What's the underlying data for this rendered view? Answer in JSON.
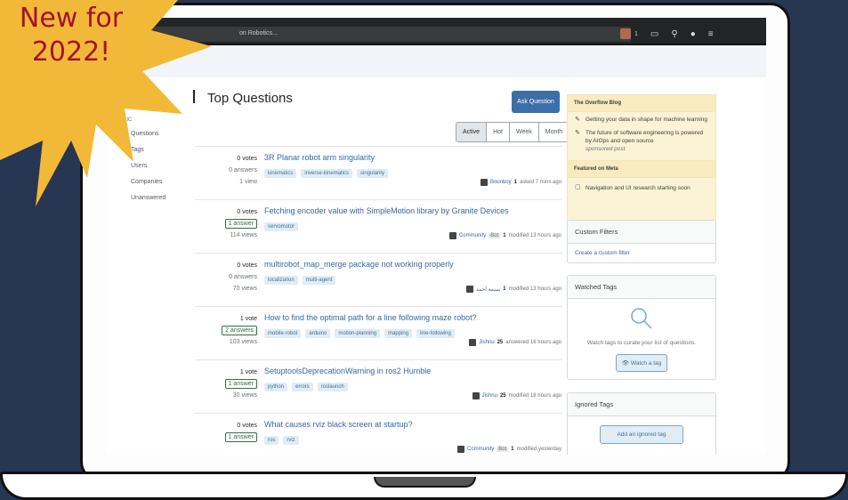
{
  "promo": {
    "line1": "New for",
    "line2": "2022!"
  },
  "topbar": {
    "search_placeholder": "on Robotics...",
    "rep": "1"
  },
  "nav": {
    "section": "LIC",
    "items": [
      "Questions",
      "Tags",
      "Users",
      "Companies",
      "Unanswered"
    ]
  },
  "main": {
    "title": "Top Questions",
    "ask_button": "Ask Question",
    "filters": [
      "Active",
      "Hot",
      "Week",
      "Month"
    ],
    "questions": [
      {
        "votes": "0 votes",
        "answers": "0 answers",
        "views": "1 view",
        "answered": false,
        "title": "3R Planar robot arm singularity",
        "tags": [
          "kinematics",
          "inverse-kinematics",
          "singularity"
        ],
        "user": "Boonboy",
        "rep": "1",
        "action": "asked 7 mins ago",
        "bot": ""
      },
      {
        "votes": "0 votes",
        "answers": "1 answer",
        "views": "114 views",
        "answered": true,
        "title": "Fetching encoder value with SimpleMotion library by Granite Devices",
        "tags": [
          "servomotor"
        ],
        "user": "Community",
        "rep": "1",
        "action": "modified 13 hours ago",
        "bot": "Bot"
      },
      {
        "votes": "0 votes",
        "answers": "0 answers",
        "views": "70 views",
        "answered": false,
        "title": "multirobot_map_merge package not working properly",
        "tags": [
          "localization",
          "multi-agent"
        ],
        "user": "بسمة أحمد",
        "rep": "1",
        "action": "modified 13 hours ago",
        "bot": ""
      },
      {
        "votes": "1 vote",
        "answers": "2 answers",
        "views": "103 views",
        "answered": true,
        "title": "How to find the optimal path for a line following maze robot?",
        "tags": [
          "mobile-robot",
          "arduino",
          "motion-planning",
          "mapping",
          "line-following"
        ],
        "user": "Jishnu",
        "rep": "25",
        "action": "answered 16 hours ago",
        "bot": ""
      },
      {
        "votes": "1 vote",
        "answers": "1 answer",
        "views": "30 views",
        "answered": true,
        "title": "SetuptoolsDeprecationWarning in ros2 Humble",
        "tags": [
          "python",
          "errors",
          "roslaunch"
        ],
        "user": "Jishnu",
        "rep": "25",
        "action": "modified 18 hours ago",
        "bot": ""
      },
      {
        "votes": "0 votes",
        "answers": "1 answer",
        "views": "",
        "answered": true,
        "title": "What causes rviz black screen at startup?",
        "tags": [
          "ros",
          "rviz"
        ],
        "user": "Community",
        "rep": "1",
        "action": "modified yesterday",
        "bot": "Bot"
      }
    ]
  },
  "sidebar": {
    "blog_title": "The Overflow Blog",
    "blog_items": [
      {
        "text": "Getting your data in shape for machine learning",
        "sub": ""
      },
      {
        "text": "The future of software engineering is powered by AIOps and open source",
        "sub": "sponsored post"
      }
    ],
    "meta_title": "Featured on Meta",
    "meta_items": [
      "Navigation and UI research starting soon"
    ],
    "custom_filters": {
      "title": "Custom Filters",
      "link": "Create a custom filter"
    },
    "watched_tags": {
      "title": "Watched Tags",
      "text": "Watch tags to curate your list of questions.",
      "button": "Watch a tag"
    },
    "ignored_tags": {
      "title": "Ignored Tags",
      "button": "Add an ignored tag"
    }
  }
}
